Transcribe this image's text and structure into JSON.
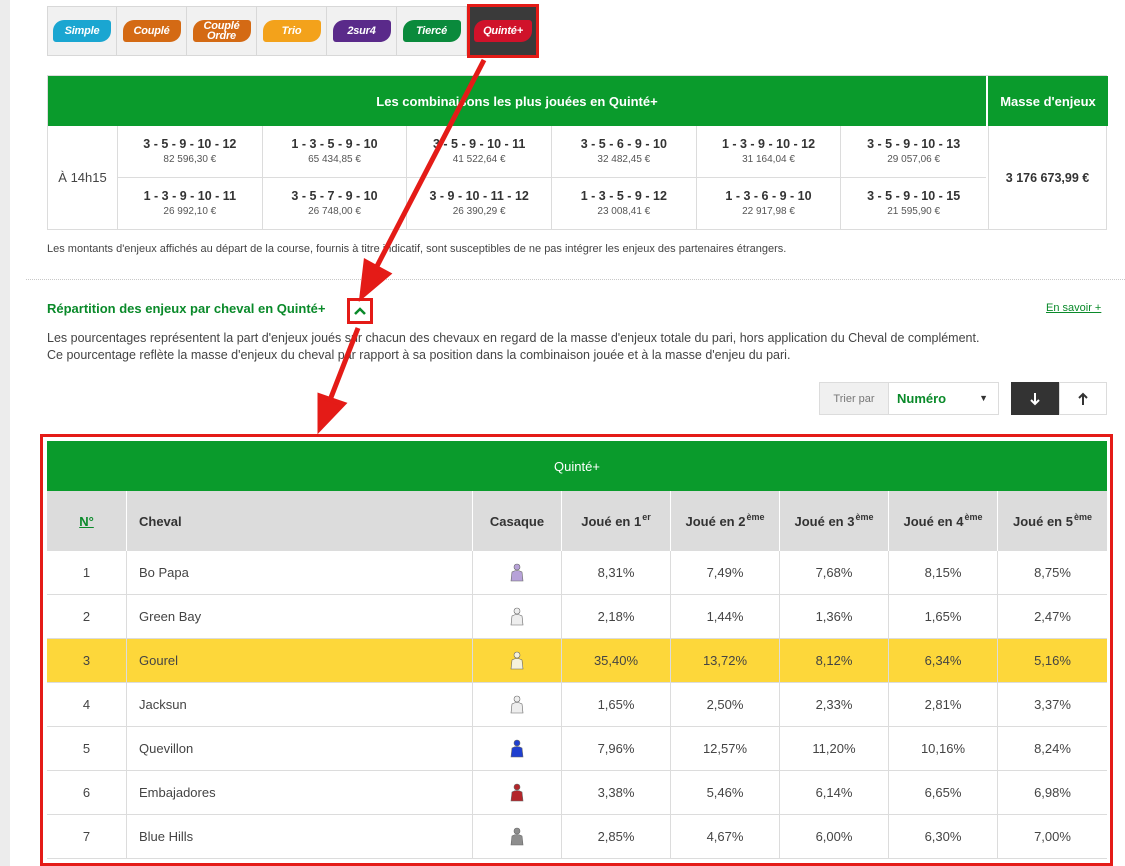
{
  "bet_tabs": [
    {
      "label": "Simple",
      "color": "#1aa6d1",
      "active": false
    },
    {
      "label": "Couplé",
      "color": "#d46a14",
      "active": false
    },
    {
      "label": "Couplé Ordre",
      "color": "#d46a14",
      "active": false
    },
    {
      "label": "Trio",
      "color": "#f3a21b",
      "active": false
    },
    {
      "label": "2sur4",
      "color": "#5a2a8a",
      "active": false
    },
    {
      "label": "Tiercé",
      "color": "#0a8a3c",
      "active": false
    },
    {
      "label": "Quinté+",
      "color": "#d0122a",
      "active": true
    }
  ],
  "combos": {
    "title": "Les combinaisons les plus jouées en Quinté+",
    "mass_header": "Masse d'enjeux",
    "time": "À 14h15",
    "total": "3 176 673,99 €",
    "cells": [
      {
        "combo": "3 - 5 - 9 - 10 - 12",
        "amount": "82 596,30 €"
      },
      {
        "combo": "1 - 3 - 5 - 9 - 10",
        "amount": "65 434,85 €"
      },
      {
        "combo": "3 - 5 - 9 - 10 - 11",
        "amount": "41 522,64 €"
      },
      {
        "combo": "3 - 5 - 6 - 9 - 10",
        "amount": "32 482,45 €"
      },
      {
        "combo": "1 - 3 - 9 - 10 - 12",
        "amount": "31 164,04 €"
      },
      {
        "combo": "3 - 5 - 9 - 10 - 13",
        "amount": "29 057,06 €"
      },
      {
        "combo": "1 - 3 - 9 - 10 - 11",
        "amount": "26 992,10 €"
      },
      {
        "combo": "3 - 5 - 7 - 9 - 10",
        "amount": "26 748,00 €"
      },
      {
        "combo": "3 - 9 - 10 - 11 - 12",
        "amount": "26 390,29 €"
      },
      {
        "combo": "1 - 3 - 5 - 9 - 12",
        "amount": "23 008,41 €"
      },
      {
        "combo": "1 - 3 - 6 - 9 - 10",
        "amount": "22 917,98 €"
      },
      {
        "combo": "3 - 5 - 9 - 10 - 15",
        "amount": "21 595,90 €"
      }
    ]
  },
  "note": "Les montants d'enjeux affichés au départ de la course, fournis à titre indicatif, sont susceptibles de ne pas intégrer les enjeux des partenaires étrangers.",
  "section": {
    "title": "Répartition des enjeux par cheval en Quinté+",
    "learn_more": "En savoir +",
    "desc_line1": "Les pourcentages représentent la part d'enjeux joués sur chacun des chevaux en regard de la masse d'enjeux totale du pari, hors application du Cheval de complément.",
    "desc_line2": "Ce pourcentage reflète la masse d'enjeux du cheval par rapport à sa position dans la combinaison jouée et à la masse d'enjeu du pari.",
    "toggle_icon": "chevron-up-icon"
  },
  "sort": {
    "label": "Trier par",
    "value": "Numéro",
    "down_icon": "arrow-down-icon",
    "up_icon": "arrow-up-icon"
  },
  "table": {
    "title": "Quinté+",
    "headers": {
      "num": "N°",
      "name": "Cheval",
      "casaque": "Casaque",
      "p1": "Joué en 1",
      "p1_sup": "er",
      "p2": "Joué en 2",
      "p2_sup": "ème",
      "p3": "Joué en 3",
      "p3_sup": "ème",
      "p4": "Joué en 4",
      "p4_sup": "ème",
      "p5": "Joué en 5",
      "p5_sup": "ème"
    },
    "highlight_color": "#fdd73a",
    "rows": [
      {
        "num": "1",
        "name": "Bo Papa",
        "silk": "#b7a2d8",
        "p": [
          "8,31%",
          "7,49%",
          "7,68%",
          "8,15%",
          "8,75%"
        ]
      },
      {
        "num": "2",
        "name": "Green Bay",
        "silk": "#eeeeee",
        "p": [
          "2,18%",
          "1,44%",
          "1,36%",
          "1,65%",
          "2,47%"
        ]
      },
      {
        "num": "3",
        "name": "Gourel",
        "silk": "#f5f2dc",
        "p": [
          "35,40%",
          "13,72%",
          "8,12%",
          "6,34%",
          "5,16%"
        ]
      },
      {
        "num": "4",
        "name": "Jacksun",
        "silk": "#eeeeee",
        "p": [
          "1,65%",
          "2,50%",
          "2,33%",
          "2,81%",
          "3,37%"
        ]
      },
      {
        "num": "5",
        "name": "Quevillon",
        "silk": "#1f3fcf",
        "p": [
          "7,96%",
          "12,57%",
          "11,20%",
          "10,16%",
          "8,24%"
        ]
      },
      {
        "num": "6",
        "name": "Embajadores",
        "silk": "#b3262a",
        "p": [
          "3,38%",
          "5,46%",
          "6,14%",
          "6,65%",
          "6,98%"
        ]
      },
      {
        "num": "7",
        "name": "Blue Hills",
        "silk": "#8e8e8e",
        "p": [
          "2,85%",
          "4,67%",
          "6,00%",
          "6,30%",
          "7,00%"
        ]
      }
    ]
  }
}
